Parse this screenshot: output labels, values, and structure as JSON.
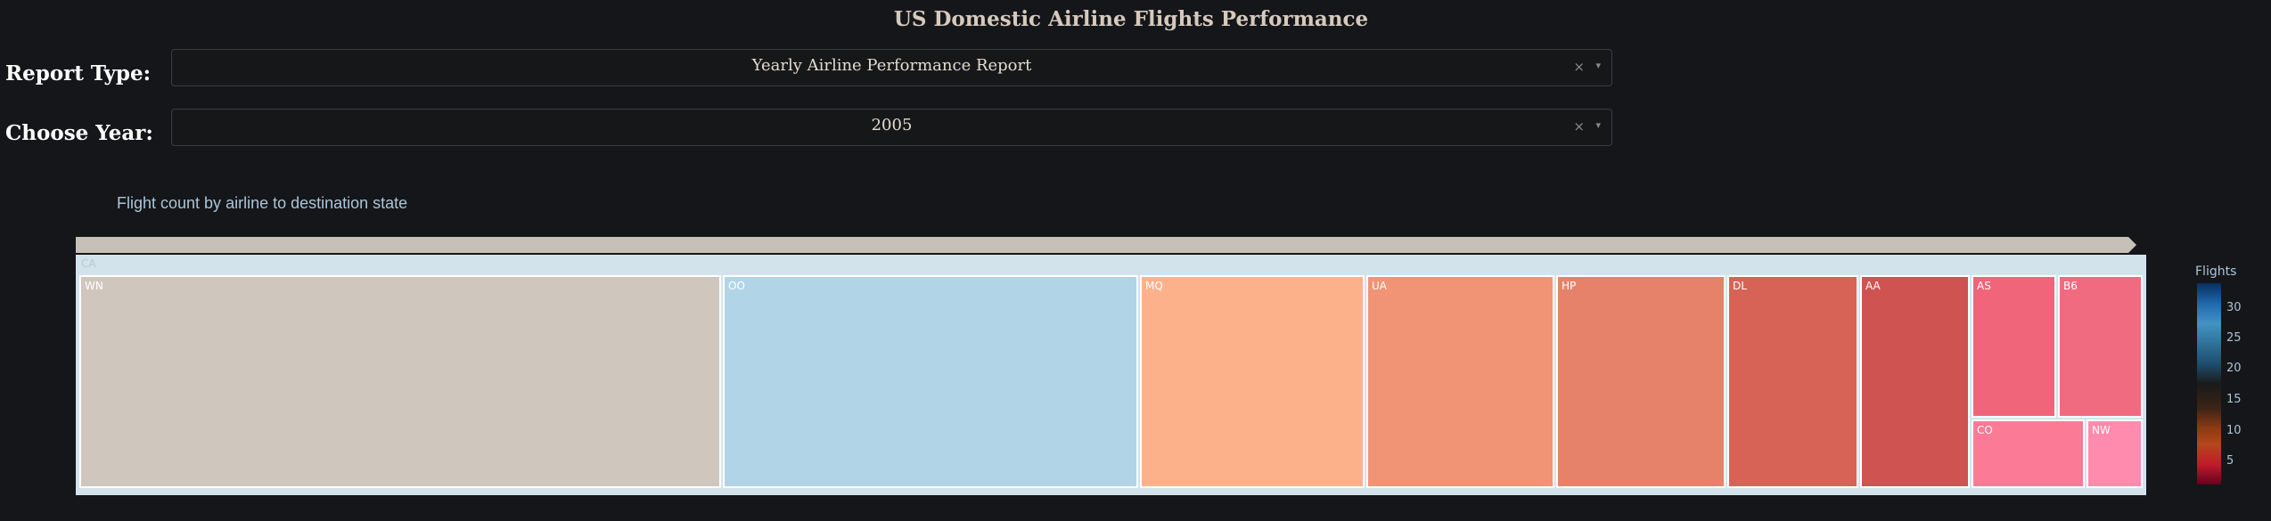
{
  "header": {
    "title": "US Domestic Airline Flights Performance"
  },
  "controls": {
    "report_type_label": "Report Type:",
    "report_type_value": "Yearly Airline Performance Report",
    "year_label": "Choose Year:",
    "year_value": "2005",
    "clear_glyph": "×",
    "arrow_glyph": "▾"
  },
  "chart": {
    "title": "Flight count by airline to destination state",
    "colorbar_title": "Flights",
    "colorbar_ticks": [
      "30",
      "25",
      "20",
      "15",
      "10",
      "5"
    ]
  },
  "chart_data": {
    "type": "treemap",
    "root": "CA",
    "leaves": [
      {
        "label": "WN",
        "color": "#cfc6bd"
      },
      {
        "label": "OO",
        "color": "#b1d5e6"
      },
      {
        "label": "MQ",
        "color": "#fdb18b"
      },
      {
        "label": "UA",
        "color": "#f09475"
      },
      {
        "label": "HP",
        "color": "#e6826a"
      },
      {
        "label": "DL",
        "color": "#d66356"
      },
      {
        "label": "AA",
        "color": "#cf5350"
      },
      {
        "label": "AS",
        "color": "#f06579"
      },
      {
        "label": "B6",
        "color": "#f06b80"
      },
      {
        "label": "CO",
        "color": "#fb7a96"
      },
      {
        "label": "NW",
        "color": "#ff8bae"
      }
    ]
  }
}
